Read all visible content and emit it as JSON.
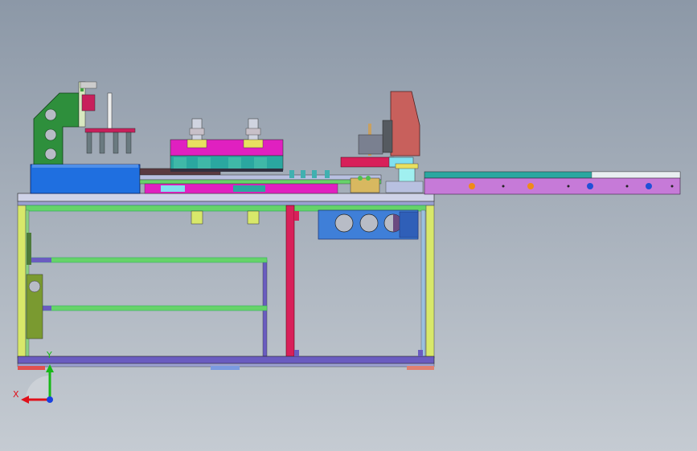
{
  "viewport": {
    "background_top": "#8c98a7",
    "background_bottom": "#c5cbd2"
  },
  "triad": {
    "x_label": "X",
    "y_label": "Y",
    "x_color": "#e0101a",
    "y_color": "#18b818",
    "z_color": "#1840e0"
  },
  "colors": {
    "frame_yellow": "#d8e86a",
    "frame_green": "#66d36a",
    "frame_purple": "#6a5cc0",
    "frame_red": "#d8205a",
    "conveyor_violet": "#c67ad8",
    "bracket_green": "#2e8f3c",
    "box_blue": "#1f6fe0",
    "box_salmon": "#c8605c",
    "block_magenta": "#e020c0",
    "block_teal": "#2aa7a0",
    "block_cyan": "#80e0f0",
    "plate_blue": "#3f7fd8",
    "hole_grey": "#b8bcc6",
    "dot_orange": "#f08a18",
    "dot_blue": "#2050d8",
    "olive": "#7a9a30"
  }
}
